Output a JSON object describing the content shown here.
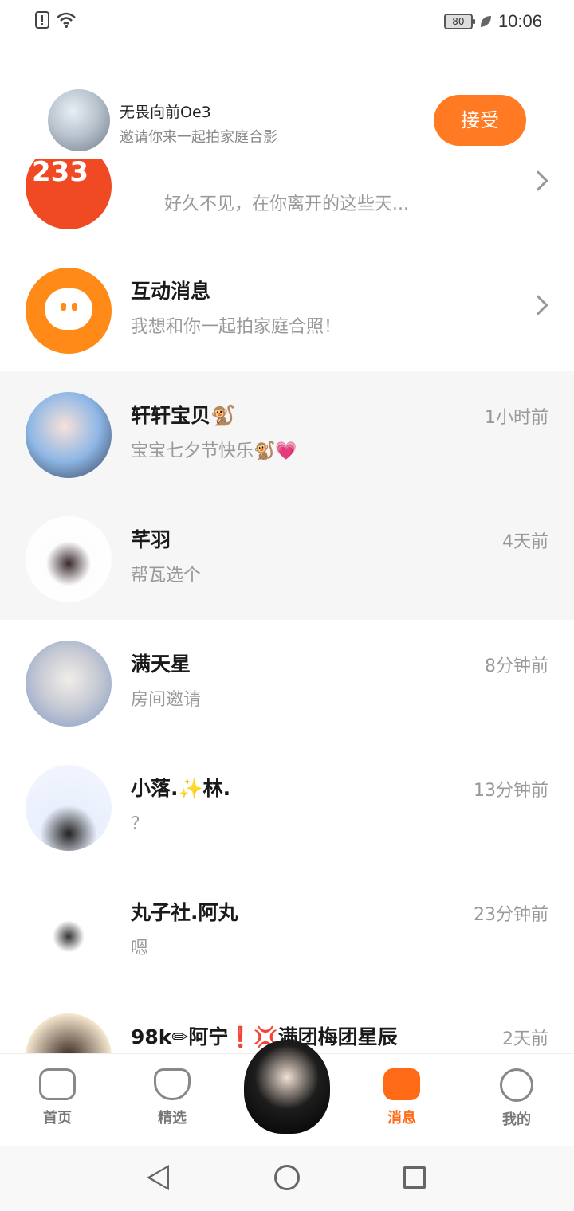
{
  "status_bar": {
    "time": "10:06",
    "battery": "80"
  },
  "invite": {
    "name": "无畏向前Oe3",
    "message": "邀请你来一起拍家庭合影",
    "accept_label": "接受"
  },
  "rows": [
    {
      "title": "",
      "subtitle": "好久不见，在你离开的这些天...",
      "time": "",
      "avatar_text": "233"
    },
    {
      "title": "互动消息",
      "subtitle": "我想和你一起拍家庭合照！",
      "time": ""
    },
    {
      "title": "轩轩宝贝🐒",
      "subtitle": "宝宝七夕节快乐🐒💗",
      "time": "1小时前"
    },
    {
      "title": "芊羽",
      "subtitle": "帮瓦选个",
      "time": "4天前"
    },
    {
      "title": "满天星",
      "subtitle": "房间邀请",
      "time": "8分钟前"
    },
    {
      "title": "小落.✨林.",
      "subtitle": "？",
      "time": "13分钟前"
    },
    {
      "title": "丸子社.阿丸",
      "subtitle": "嗯",
      "time": "23分钟前"
    },
    {
      "title": "98k✏阿宁❗💢满团梅团星辰",
      "subtitle": "",
      "time": "2天前"
    }
  ],
  "bottom_nav": [
    {
      "label": "首页",
      "icon": "gamepad-icon"
    },
    {
      "label": "精选",
      "icon": "heart-icon"
    },
    {
      "label": "消息",
      "icon": "message-icon"
    },
    {
      "label": "我的",
      "icon": "profile-face-icon"
    }
  ],
  "colors": {
    "accent": "#ff7a22",
    "active_tab": "#ff6a17"
  }
}
